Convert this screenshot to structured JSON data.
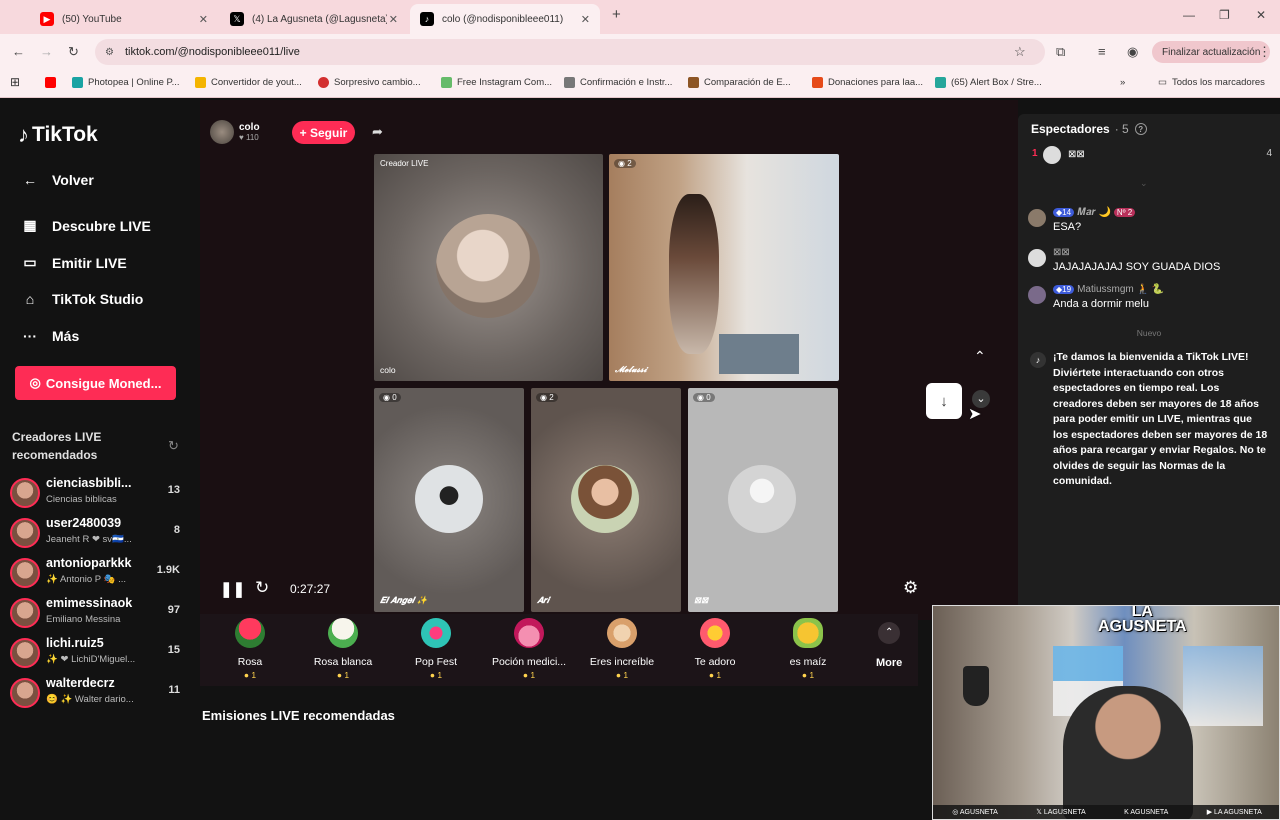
{
  "browser": {
    "tabs": [
      {
        "title": "(50) YouTube",
        "color": "#ff0000",
        "icon": "youtube-icon"
      },
      {
        "title": "(4) La Agusneta (@Lagusneta) /",
        "color": "#000000",
        "icon": "x-icon"
      },
      {
        "title": "colo (@nodisponibleee011)",
        "color": "#000000",
        "icon": "tiktok-icon"
      }
    ],
    "url": "tiktok.com/@nodisponibleee011/live",
    "update_label": "Finalizar actualización",
    "bookmarks": [
      {
        "label": "Photopea | Online P...",
        "color": "#1aa3a3"
      },
      {
        "label": "Convertidor de yout...",
        "color": "#f4b400"
      },
      {
        "label": "Sorpresivo cambio...",
        "color": "#d32f2f"
      },
      {
        "label": "Free Instagram Com...",
        "color": "#66bb6a"
      },
      {
        "label": "Confirmación e Instr...",
        "color": "#777777"
      },
      {
        "label": "Comparación de E...",
        "color": "#8d5524"
      },
      {
        "label": "Donaciones para laa...",
        "color": "#e64a19"
      },
      {
        "label": "(65) Alert Box / Stre...",
        "color": "#26a69a"
      }
    ],
    "all_bookmarks": "Todos los marcadores"
  },
  "sidebar": {
    "logo": "TikTok",
    "back": "Volver",
    "items": [
      {
        "label": "Descubre LIVE",
        "icon": "calendar-live-icon"
      },
      {
        "label": "Emitir LIVE",
        "icon": "camera-icon"
      },
      {
        "label": "TikTok Studio",
        "icon": "home-studio-icon"
      },
      {
        "label": "Más",
        "icon": "more-dots-icon"
      }
    ],
    "coins_button": "Consigue Moned...",
    "recommended_title": "Creadores LIVE recomendados",
    "creators": [
      {
        "name": "cienciasbibli...",
        "sub": "Ciencias biblicas",
        "count": "13"
      },
      {
        "name": "user2480039",
        "sub": "Jeaneht R ❤ sv🇸🇻...",
        "count": "8"
      },
      {
        "name": "antonioparkkk",
        "sub": "✨ Antonio P 🎭 ...",
        "count": "1.9K"
      },
      {
        "name": "emimessinaok",
        "sub": "Emiliano Messina",
        "count": "97"
      },
      {
        "name": "lichi.ruiz5",
        "sub": "✨ ❤ LichiD'Miguel...",
        "count": "15"
      },
      {
        "name": "walterdecrz",
        "sub": "😊 ✨ Walter dario...",
        "count": "11"
      }
    ]
  },
  "stream": {
    "host_name": "colo",
    "host_likes": "♥ 110",
    "follow": "+ Seguir",
    "cells": [
      {
        "tag": "Creador LIVE",
        "name": "colo"
      },
      {
        "tag": "2",
        "name": "𝓜𝓮𝓵𝓾𝓼𝓼𝓲"
      },
      {
        "tag": "0",
        "name": "𝑬𝒍 𝑨𝒏𝒈𝒆𝒍 ✨"
      },
      {
        "tag": "2",
        "name": "𝑨𝒓𝒊"
      },
      {
        "tag": "0",
        "name": "⊠⊠"
      }
    ],
    "time": "0:27:27"
  },
  "gifts": [
    {
      "name": "Rosa",
      "price": "1",
      "color": "#e0204a",
      "icon": "rose-icon"
    },
    {
      "name": "Rosa blanca",
      "price": "1",
      "color": "#f2f0e6",
      "icon": "white-rose-icon"
    },
    {
      "name": "Pop Fest",
      "price": "1",
      "color": "#2ec4b6",
      "icon": "pop-fest-icon"
    },
    {
      "name": "Poción medici...",
      "price": "1",
      "color": "#f48fb1",
      "icon": "potion-icon"
    },
    {
      "name": "Eres increíble",
      "price": "1",
      "color": "#d9a06b",
      "icon": "cat-icon"
    },
    {
      "name": "Te adoro",
      "price": "1",
      "color": "#ff5a6e",
      "icon": "heart-face-icon"
    },
    {
      "name": "es maíz",
      "price": "1",
      "color": "#f6c531",
      "icon": "corn-icon"
    }
  ],
  "more_label": "More",
  "recommended_live": "Emisiones LIVE recomendadas",
  "chat": {
    "title": "Espectadores",
    "count": "· 5",
    "top_viewer_rank": "1",
    "top_viewer_name": "⊠⊠",
    "top_viewer_score": "4",
    "messages": [
      {
        "user": "𝑴𝒂𝒓 🌙",
        "level": "14",
        "badge": "Nº 2",
        "text": "ESA?"
      },
      {
        "user": "⊠⊠",
        "level": "",
        "badge": "",
        "text": "JAJAJAJAJAJ SOY GUADA DIOS"
      },
      {
        "user": "Matiussmgm 🧎 🐍",
        "level": "19",
        "badge": "",
        "text": "Anda a dormir melu"
      }
    ],
    "new_label": "Nuevo",
    "welcome": "¡Te damos la bienvenida a TikTok LIVE! Diviértete interactuando con otros espectadores en tiempo real. Los creadores deben ser mayores de 18 años para poder emitir un LIVE, mientras que los espectadores deben ser mayores de 18 años para recargar y enviar Regalos. No te olvides de seguir las Normas de la comunidad."
  },
  "webcam": {
    "logo_line1": "LA",
    "logo_line2": "AGUSNETA",
    "banner": [
      "AGUSNETA",
      "LAGUSNETA",
      "AGUSNETA",
      "LA AGUSNETA"
    ]
  }
}
